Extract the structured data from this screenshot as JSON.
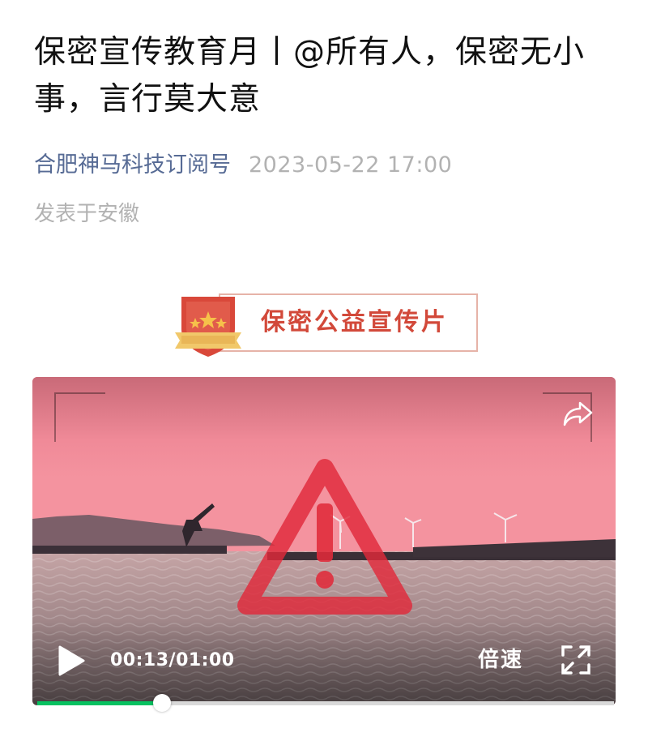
{
  "article": {
    "title": "保密宣传教育月丨@所有人，保密无小事，言行莫大意",
    "account_name": "合肥神马科技订阅号",
    "publish_time": "2023-05-22 17:00",
    "location": "发表于安徽"
  },
  "banner": {
    "text": "保密公益宣传片",
    "icon": "shield-stars-icon"
  },
  "video": {
    "current_time": "00:13",
    "duration": "01:00",
    "time_display": "00:13/01:00",
    "speed_label": "倍速",
    "progress_fraction": 0.2167,
    "icons": {
      "play": "play-icon",
      "share": "share-icon",
      "fullscreen": "fullscreen-icon",
      "overlay": "warning-triangle-icon"
    }
  },
  "colors": {
    "link": "#576b95",
    "meta_gray": "#b2b2b2",
    "banner_red": "#d2493a",
    "progress_green": "#07c160"
  }
}
